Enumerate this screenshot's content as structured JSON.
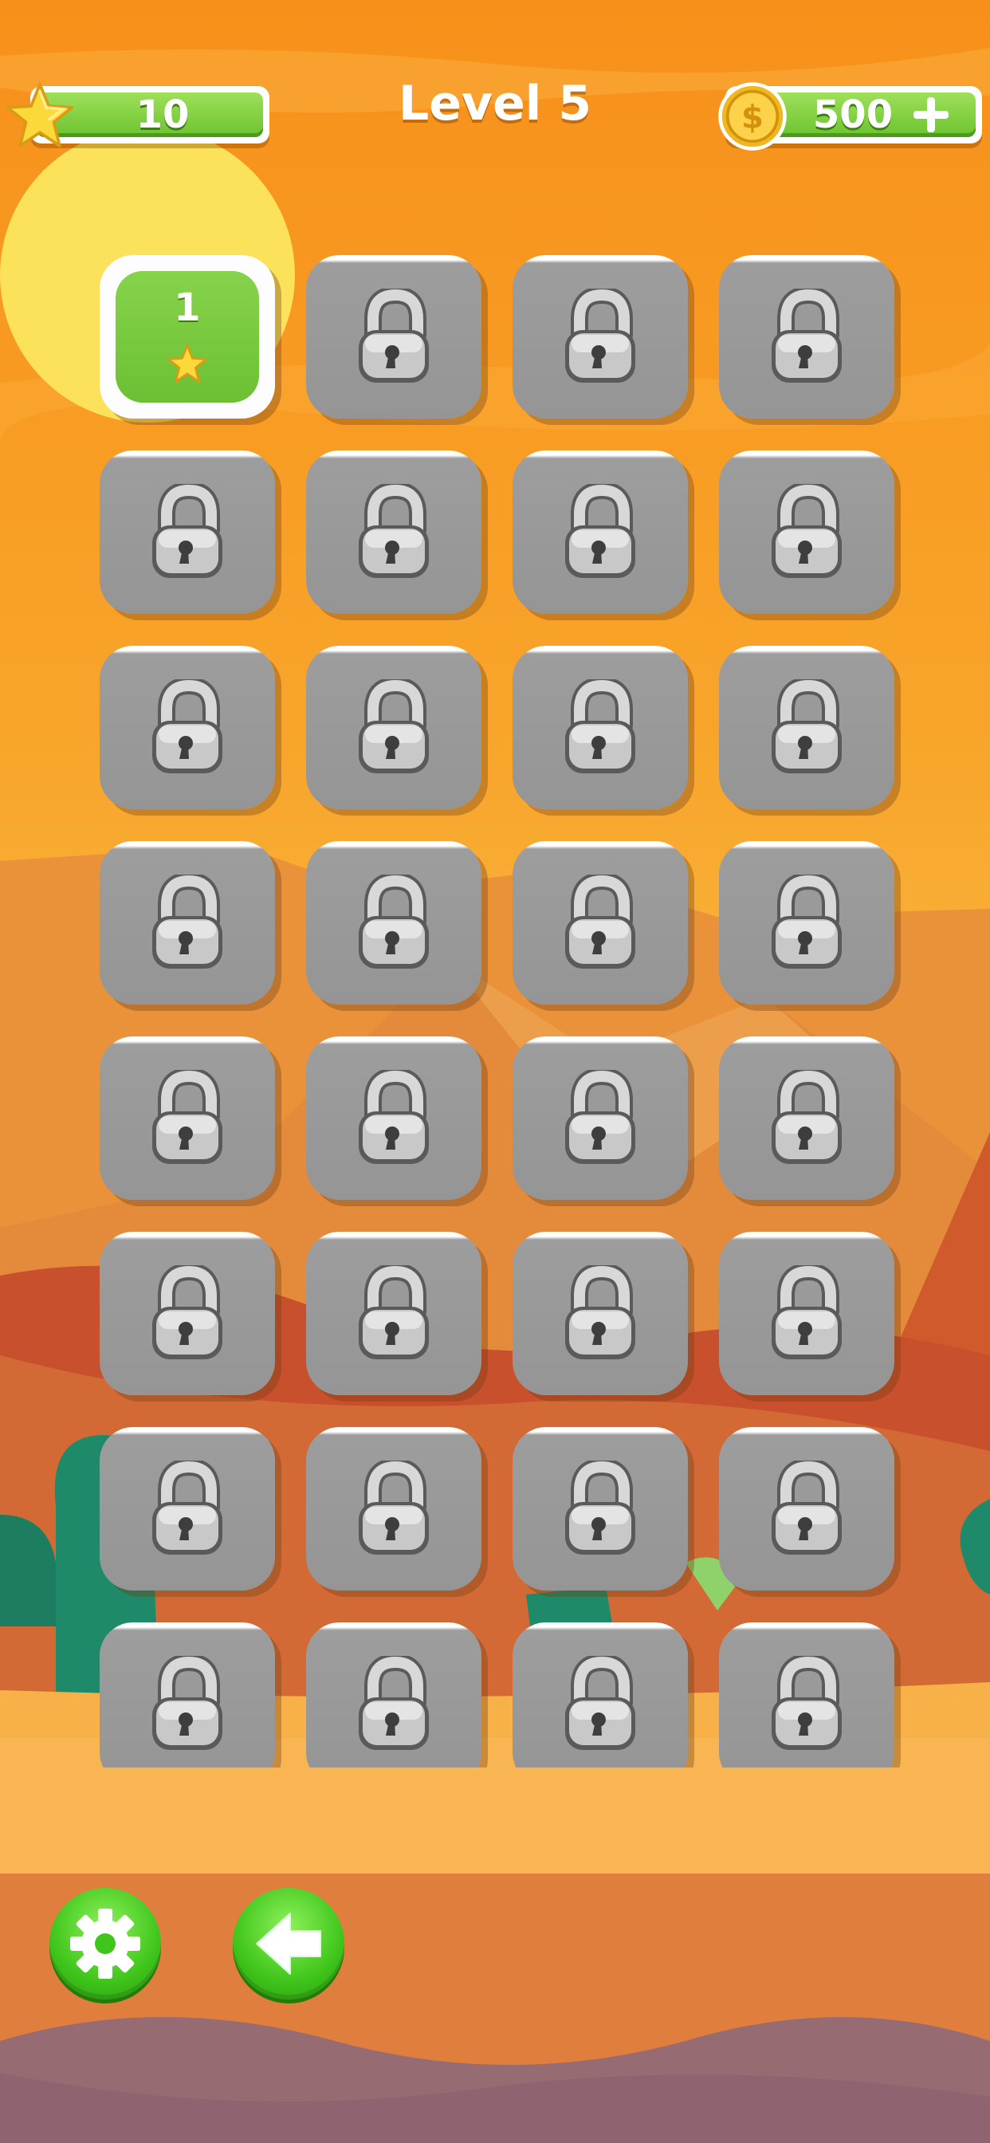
{
  "hud": {
    "stars": "10",
    "level_title": "Level 5",
    "coins": "500",
    "add_icon": "plus-icon"
  },
  "levels": [
    {
      "number": "1",
      "locked": false,
      "stars": 1
    },
    {
      "locked": true
    },
    {
      "locked": true
    },
    {
      "locked": true
    },
    {
      "locked": true
    },
    {
      "locked": true
    },
    {
      "locked": true
    },
    {
      "locked": true
    },
    {
      "locked": true
    },
    {
      "locked": true
    },
    {
      "locked": true
    },
    {
      "locked": true
    },
    {
      "locked": true
    },
    {
      "locked": true
    },
    {
      "locked": true
    },
    {
      "locked": true
    },
    {
      "locked": true
    },
    {
      "locked": true
    },
    {
      "locked": true
    },
    {
      "locked": true
    },
    {
      "locked": true
    },
    {
      "locked": true
    },
    {
      "locked": true
    },
    {
      "locked": true
    },
    {
      "locked": true
    },
    {
      "locked": true
    },
    {
      "locked": true
    },
    {
      "locked": true
    },
    {
      "locked": true
    },
    {
      "locked": true
    },
    {
      "locked": true
    },
    {
      "locked": true
    }
  ],
  "buttons": {
    "settings_icon": "gear-icon",
    "back_icon": "back-arrow-icon"
  },
  "colors": {
    "sky_top": "#f7941e",
    "accent_green": "#6cc32f",
    "tile_gray": "#9a9a9a"
  }
}
